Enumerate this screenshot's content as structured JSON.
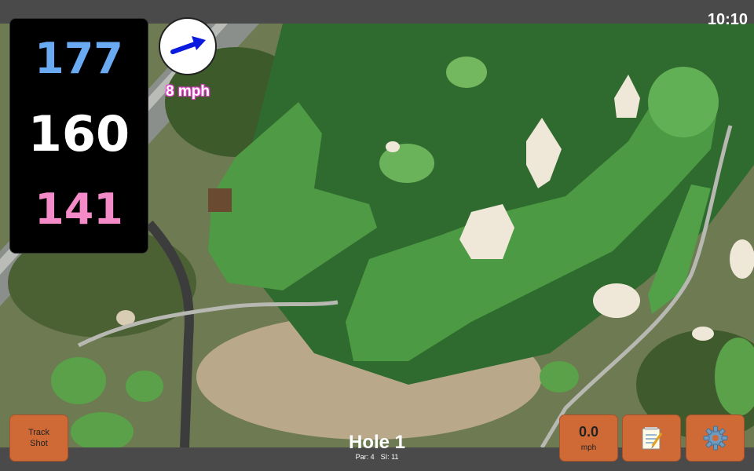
{
  "status": {
    "time": "10:10"
  },
  "distances": {
    "back": {
      "value": "177",
      "color": "#6aaaf2"
    },
    "middle": {
      "value": "160",
      "color": "#ffffff"
    },
    "front": {
      "value": "141",
      "color": "#f58ac8"
    }
  },
  "wind": {
    "speed_label": "8 mph",
    "arrow_color": "#0a1adf",
    "label_color": "#e040c8"
  },
  "buttons": {
    "track_shot": {
      "line1": "Track",
      "line2": "Shot"
    },
    "speed": {
      "value": "0.0",
      "unit": "mph"
    },
    "notes_icon": "notepad-icon",
    "settings_icon": "gear-icon"
  },
  "hole": {
    "title": "Hole 1",
    "par": "Par: 4",
    "stroke_index": "SI: 11"
  },
  "colors": {
    "accent_button": "#cf6a37",
    "frame": "#4a4a4a"
  }
}
